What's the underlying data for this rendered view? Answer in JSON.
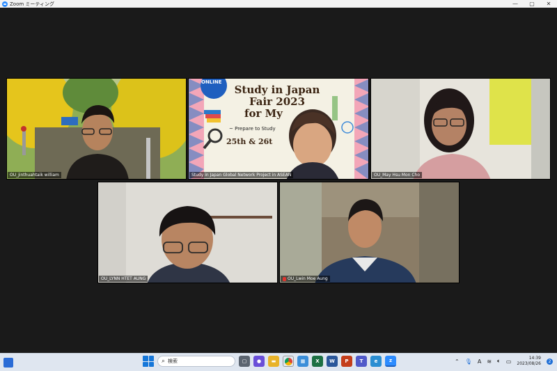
{
  "window": {
    "title": "Zoom ミーティング",
    "controls": [
      "—",
      "▢",
      "✕"
    ]
  },
  "participants": [
    {
      "name": "OU_jinthuahtaik william",
      "muted": false
    },
    {
      "name": "Study in Japan Global Network Project in ASEAN",
      "muted": false
    },
    {
      "name": "OU_May Hsu Mon Cho",
      "muted": false
    },
    {
      "name": "OU_LYNN HTET AUNG",
      "muted": false
    },
    {
      "name": "OU_Lwin Moe Aung",
      "muted": true
    }
  ],
  "slide": {
    "badge": "ONLINE",
    "title_line1": "Study in Japan",
    "title_line2": "Fair 2023",
    "title_line3": "for My",
    "subtitle": "~ Prepare to Study",
    "dates": "25th & 26t"
  },
  "taskbar": {
    "search_placeholder": "検索",
    "time": "14:39",
    "date": "2023/08/26",
    "notification_count": "2",
    "ime_indicator": "A"
  },
  "colors": {
    "zoom_blue": "#2d8cff",
    "taskbar_bg": "#dfe6f0",
    "muted_red": "#e0362f"
  }
}
